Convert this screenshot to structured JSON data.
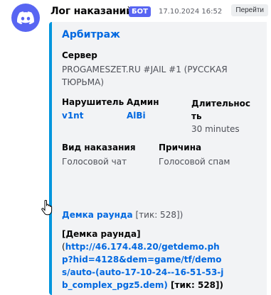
{
  "message": {
    "author": "Лог наказаний",
    "bot_badge": "БОТ",
    "timestamp": "17.10.2024 16:52",
    "goto_label": "Перейти"
  },
  "embed": {
    "accent_color": "#0095dd",
    "title": "Арбитраж",
    "server": {
      "name": "Сервер",
      "value": "PROGAMESZET.RU #JAIL #1 (РУССКАЯ ТЮРЬМА)"
    },
    "violator": {
      "name": "Нарушитель",
      "value": "v1nt"
    },
    "admin": {
      "name": "Админ",
      "value": "AlBi"
    },
    "duration": {
      "name": "Длительнос ть",
      "value": "30 minutes"
    },
    "punishment_type": {
      "name": "Вид наказания",
      "value": "Голосовой чат"
    },
    "reason": {
      "name": "Причина",
      "value": "Голосовой спам"
    },
    "demo": {
      "title": "Демка раунда",
      "tick": "[тик: 528])",
      "desc_title": "[Демка раунда]",
      "open_paren": "(",
      "url": "http://46.174.48.20/getdemo.php?hid=4128&dem=game/tf/demos/auto-(auto-17-10-24--16-51-53-jb_complex_pgz5.dem)",
      "desc_tick": " [тик: 528])"
    }
  },
  "icons": {
    "avatar": "discord-logo-icon",
    "cursor": "hand-pointer-icon"
  }
}
